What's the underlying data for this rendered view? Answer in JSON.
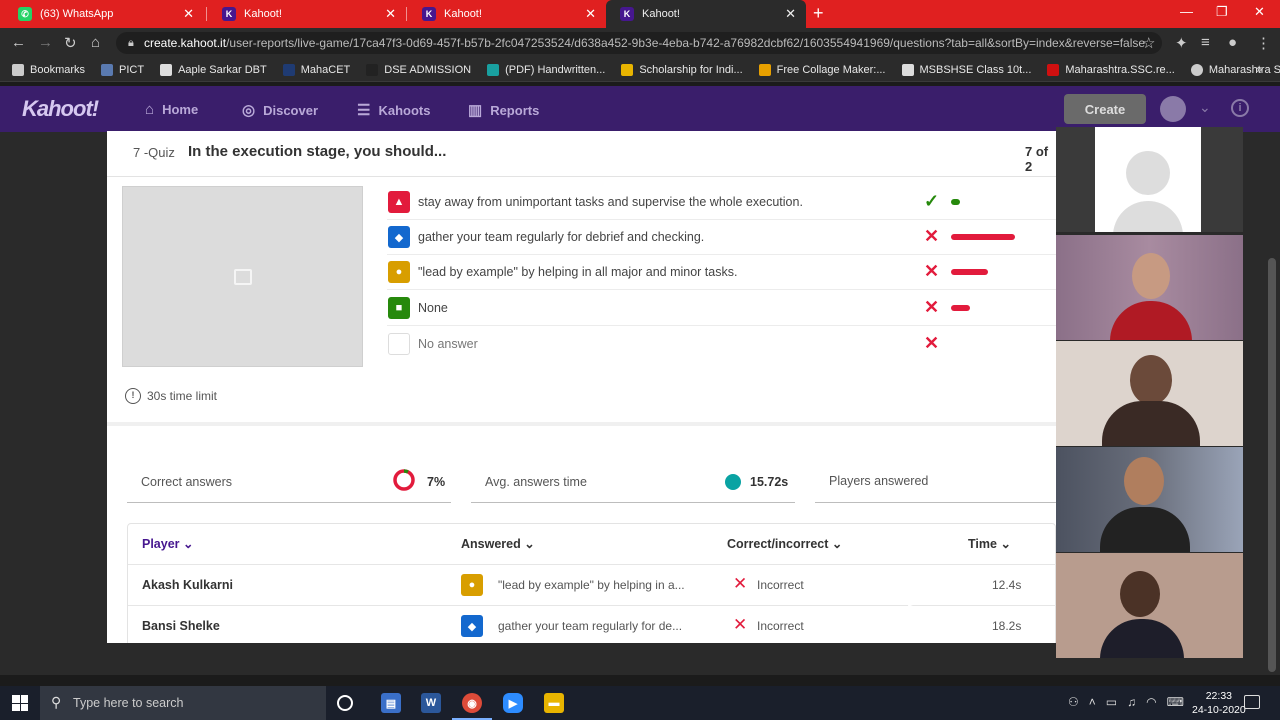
{
  "browser": {
    "tabs": [
      {
        "title": "(63) WhatsApp"
      },
      {
        "title": "Kahoot!"
      },
      {
        "title": "Kahoot!"
      },
      {
        "title": "Kahoot!"
      }
    ],
    "url_host": "create.kahoot.it",
    "url_path": "/user-reports/live-game/17ca47f3-0d69-457f-b57b-2fc047253524/d638a452-9b3e-4eba-b742-a76982dcbf62/1603554941969/questions?tab=all&sortBy=index&reverse=false",
    "bookmarks": [
      {
        "label": "Bookmarks",
        "color": "#cccccc"
      },
      {
        "label": "PICT",
        "color": "#5a7ab0"
      },
      {
        "label": "Aaple Sarkar DBT",
        "color": "#dddddd"
      },
      {
        "label": "MahaCET",
        "color": "#1f3b73"
      },
      {
        "label": "DSE ADMISSION",
        "color": "#222222"
      },
      {
        "label": "(PDF) Handwritten...",
        "color": "#19a0a0"
      },
      {
        "label": "Scholarship for Indi...",
        "color": "#e8b400"
      },
      {
        "label": "Free Collage Maker:...",
        "color": "#e8a000"
      },
      {
        "label": "MSBSHSE Class 10t...",
        "color": "#dddddd"
      },
      {
        "label": "Maharashtra.SSC.re...",
        "color": "#d01010"
      },
      {
        "label": "Maharashtra State...",
        "color": "#cccccc"
      }
    ]
  },
  "kahoot_nav": {
    "logo": "Kahoot!",
    "items": [
      "Home",
      "Discover",
      "Kahoots",
      "Reports"
    ],
    "create_label": "Create"
  },
  "question": {
    "number": "7 -Quiz",
    "title": "In the execution stage, you should...",
    "count": "7 of 2",
    "time_limit": "30s time limit",
    "answers": [
      {
        "text": "stay away from unimportant tasks and supervise the whole execution.",
        "shape": "triangle",
        "color": "#e21b3c",
        "correct": true,
        "share": 0.07
      },
      {
        "text": "gather your team regularly for debrief and checking.",
        "shape": "diamond",
        "color": "#1368ce",
        "correct": false,
        "share": 0.43
      },
      {
        "text": "\"lead by example\" by helping in all major and minor tasks.",
        "shape": "circle",
        "color": "#d89e00",
        "correct": false,
        "share": 0.25
      },
      {
        "text": "None",
        "shape": "square",
        "color": "#26890c",
        "correct": false,
        "share": 0.13
      },
      {
        "text": "No answer",
        "shape": "none",
        "color": "#ffffff",
        "correct": false,
        "share": 0
      }
    ]
  },
  "stats": {
    "correct_label": "Correct answers",
    "correct_value": "7%",
    "avg_label": "Avg. answers time",
    "avg_value": "15.72s",
    "players_label": "Players answered"
  },
  "table": {
    "headers": {
      "player": "Player",
      "answered": "Answered",
      "correct": "Correct/incorrect",
      "time": "Time"
    },
    "rows": [
      {
        "player": "Akash Kulkarni",
        "answer": "\"lead by example\" by helping in a...",
        "shape": "circle",
        "color": "#d89e00",
        "result": "Incorrect",
        "time": "12.4s"
      },
      {
        "player": "Bansi Shelke",
        "answer": "gather your team regularly for de...",
        "shape": "diamond",
        "color": "#1368ce",
        "result": "Incorrect",
        "time": "18.2s"
      }
    ]
  },
  "taskbar": {
    "search_placeholder": "Type here to search",
    "time": "22:33",
    "date": "24-10-2020"
  }
}
